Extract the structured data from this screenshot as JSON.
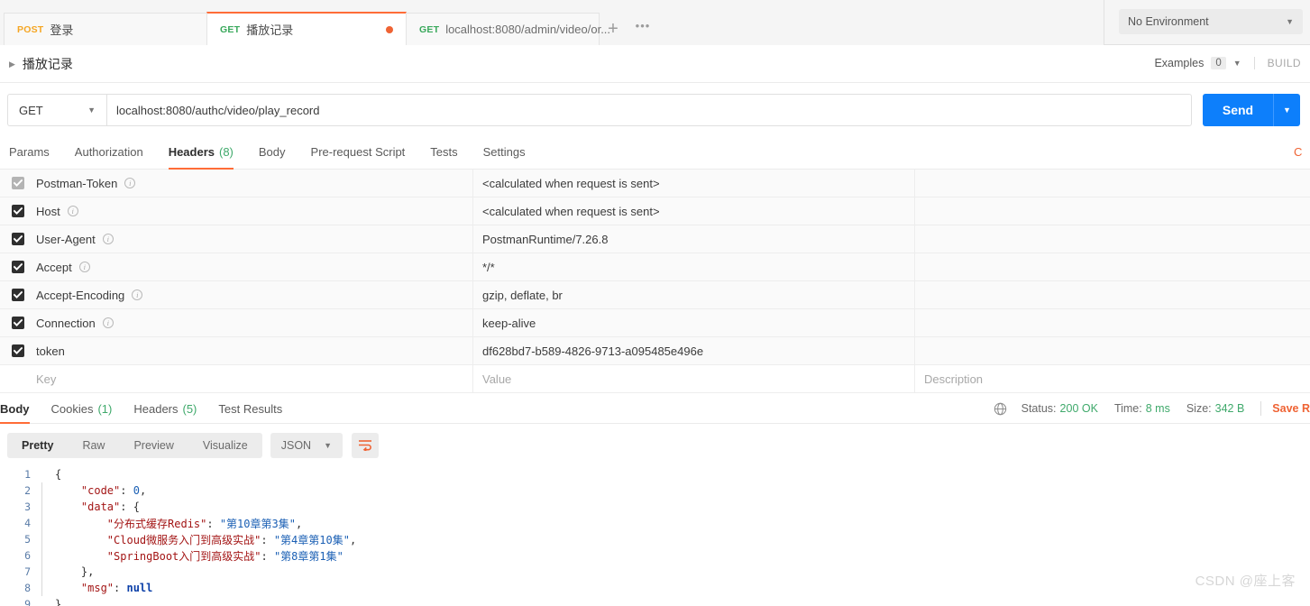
{
  "tabbar": {
    "tabs": [
      {
        "verb": "POST",
        "verb_class": "post",
        "label": "登录",
        "dirty": false,
        "active": false
      },
      {
        "verb": "GET",
        "verb_class": "get",
        "label": "播放记录",
        "dirty": true,
        "active": true
      },
      {
        "verb": "GET",
        "verb_class": "get",
        "label": "localhost:8080/admin/video/or...",
        "dirty": true,
        "active": false
      }
    ],
    "add_label": "+",
    "more_label": "•••",
    "environment": "No Environment"
  },
  "breadcrumb": {
    "title": "播放记录",
    "examples_label": "Examples",
    "examples_count": "0",
    "build_label": "BUILD"
  },
  "request": {
    "method": "GET",
    "url": "localhost:8080/authc/video/play_record",
    "send_label": "Send"
  },
  "request_tabs": [
    {
      "label": "Params",
      "count": "",
      "active": false
    },
    {
      "label": "Authorization",
      "count": "",
      "active": false
    },
    {
      "label": "Headers",
      "count": "(8)",
      "active": true
    },
    {
      "label": "Body",
      "count": "",
      "active": false
    },
    {
      "label": "Pre-request Script",
      "count": "",
      "active": false
    },
    {
      "label": "Tests",
      "count": "",
      "active": false
    },
    {
      "label": "Settings",
      "count": "",
      "active": false
    }
  ],
  "request_tabs_right_label": "C",
  "headers_table": {
    "columns": {
      "key": "Key",
      "value": "Value",
      "description": "Description"
    },
    "rows": [
      {
        "checked": true,
        "dim": true,
        "key": "Postman-Token",
        "info": true,
        "value": "<calculated when request is sent>",
        "description": ""
      },
      {
        "checked": true,
        "dim": false,
        "key": "Host",
        "info": true,
        "value": "<calculated when request is sent>",
        "description": ""
      },
      {
        "checked": true,
        "dim": false,
        "key": "User-Agent",
        "info": true,
        "value": "PostmanRuntime/7.26.8",
        "description": ""
      },
      {
        "checked": true,
        "dim": false,
        "key": "Accept",
        "info": true,
        "value": "*/*",
        "description": ""
      },
      {
        "checked": true,
        "dim": false,
        "key": "Accept-Encoding",
        "info": true,
        "value": "gzip, deflate, br",
        "description": ""
      },
      {
        "checked": true,
        "dim": false,
        "key": "Connection",
        "info": true,
        "value": "keep-alive",
        "description": ""
      },
      {
        "checked": true,
        "dim": false,
        "key": "token",
        "info": false,
        "value": "df628bd7-b589-4826-9713-a095485e496e",
        "description": ""
      }
    ]
  },
  "response_tabs": [
    {
      "label": "Body",
      "count": "",
      "active": true
    },
    {
      "label": "Cookies",
      "count": "(1)",
      "active": false
    },
    {
      "label": "Headers",
      "count": "(5)",
      "active": false
    },
    {
      "label": "Test Results",
      "count": "",
      "active": false
    }
  ],
  "response_status": {
    "status_label": "Status:",
    "status_value": "200 OK",
    "time_label": "Time:",
    "time_value": "8 ms",
    "size_label": "Size:",
    "size_value": "342 B",
    "save_label": "Save R"
  },
  "view_toolbar": {
    "modes": [
      "Pretty",
      "Raw",
      "Preview",
      "Visualize"
    ],
    "active_mode": "Pretty",
    "format": "JSON"
  },
  "response_body": {
    "lines": [
      {
        "num": "1",
        "fold": false,
        "tokens": [
          {
            "t": "{",
            "c": "c-punc"
          }
        ]
      },
      {
        "num": "2",
        "fold": true,
        "tokens": [
          {
            "t": "    ",
            "c": "c-punc"
          },
          {
            "t": "\"code\"",
            "c": "c-key"
          },
          {
            "t": ": ",
            "c": "c-punc"
          },
          {
            "t": "0",
            "c": "c-num"
          },
          {
            "t": ",",
            "c": "c-punc"
          }
        ]
      },
      {
        "num": "3",
        "fold": true,
        "tokens": [
          {
            "t": "    ",
            "c": "c-punc"
          },
          {
            "t": "\"data\"",
            "c": "c-key"
          },
          {
            "t": ": {",
            "c": "c-punc"
          }
        ]
      },
      {
        "num": "4",
        "fold": true,
        "tokens": [
          {
            "t": "        ",
            "c": "c-punc"
          },
          {
            "t": "\"分布式缓存Redis\"",
            "c": "c-key"
          },
          {
            "t": ": ",
            "c": "c-punc"
          },
          {
            "t": "\"第10章第3集\"",
            "c": "c-str"
          },
          {
            "t": ",",
            "c": "c-punc"
          }
        ]
      },
      {
        "num": "5",
        "fold": true,
        "tokens": [
          {
            "t": "        ",
            "c": "c-punc"
          },
          {
            "t": "\"Cloud微服务入门到高级实战\"",
            "c": "c-key"
          },
          {
            "t": ": ",
            "c": "c-punc"
          },
          {
            "t": "\"第4章第10集\"",
            "c": "c-str"
          },
          {
            "t": ",",
            "c": "c-punc"
          }
        ]
      },
      {
        "num": "6",
        "fold": true,
        "tokens": [
          {
            "t": "        ",
            "c": "c-punc"
          },
          {
            "t": "\"SpringBoot入门到高级实战\"",
            "c": "c-key"
          },
          {
            "t": ": ",
            "c": "c-punc"
          },
          {
            "t": "\"第8章第1集\"",
            "c": "c-str"
          }
        ]
      },
      {
        "num": "7",
        "fold": true,
        "tokens": [
          {
            "t": "    },",
            "c": "c-punc"
          }
        ]
      },
      {
        "num": "8",
        "fold": true,
        "tokens": [
          {
            "t": "    ",
            "c": "c-punc"
          },
          {
            "t": "\"msg\"",
            "c": "c-key"
          },
          {
            "t": ": ",
            "c": "c-punc"
          },
          {
            "t": "null",
            "c": "c-null"
          }
        ]
      },
      {
        "num": "9",
        "fold": false,
        "tokens": [
          {
            "t": "}",
            "c": "c-punc"
          }
        ]
      }
    ]
  },
  "watermark": "CSDN @座上客",
  "colors": {
    "accent_orange": "#ff6c37",
    "send_blue": "#0d7ffb",
    "green": "#3fa96b",
    "post_yellow": "#f5a623",
    "get_green": "#39a85b"
  }
}
